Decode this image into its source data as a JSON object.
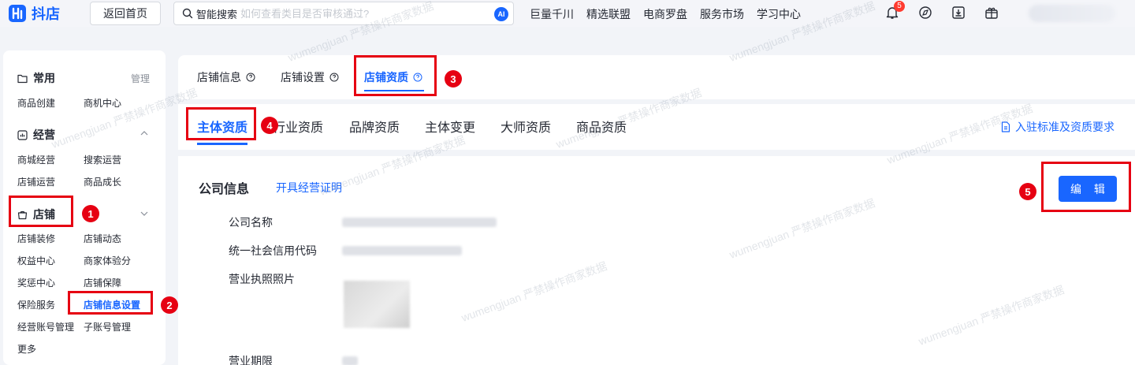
{
  "topbar": {
    "logo_text": "抖店",
    "home_button": "返回首页",
    "search_label": "智能搜索",
    "search_placeholder": "如何查看类目是否审核通过?",
    "ai_badge": "AI",
    "links": [
      "巨量千川",
      "精选联盟",
      "电商罗盘",
      "服务市场",
      "学习中心"
    ],
    "notification_count": "5"
  },
  "sidebar": {
    "common": {
      "title": "常用",
      "manage": "管理",
      "items": [
        "商品创建",
        "商机中心"
      ]
    },
    "business": {
      "title": "经营",
      "items": [
        "商城经营",
        "搜索运营",
        "店铺运营",
        "商品成长"
      ]
    },
    "store": {
      "title": "店铺",
      "items": [
        "店铺装修",
        "店铺动态",
        "权益中心",
        "商家体验分",
        "奖惩中心",
        "店铺保障",
        "保险服务",
        "店铺信息设置",
        "经营账号管理",
        "子账号管理"
      ]
    },
    "more": "更多"
  },
  "tabs": [
    "店铺信息",
    "店铺设置",
    "店铺资质"
  ],
  "subtabs": [
    "主体资质",
    "行业资质",
    "品牌资质",
    "主体变更",
    "大师资质",
    "商品资质"
  ],
  "requirements_link": "入驻标准及资质要求",
  "company": {
    "section_title": "公司信息",
    "cert_link": "开具经营证明",
    "edit_button": "编 辑",
    "fields": [
      "公司名称",
      "统一社会信用代码",
      "营业执照照片",
      "营业期限"
    ]
  },
  "annotations": [
    "1",
    "2",
    "3",
    "4",
    "5"
  ],
  "watermark": "wumengjuan 严禁操作商家数据",
  "colors": {
    "accent": "#1966ff",
    "annotation_red": "#e60012"
  }
}
